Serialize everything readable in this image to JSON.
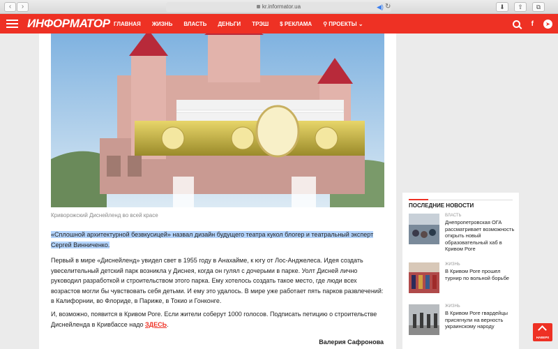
{
  "browser": {
    "url": "kr.informator.ua"
  },
  "header": {
    "logo": "ИНФОРМАТОР",
    "menu": [
      "ГЛАВНАЯ",
      "ЖИЗНЬ",
      "ВЛАСТЬ",
      "ДЕНЬГИ",
      "ТРЭШ",
      "$ РЕКЛАМА",
      "⚲ ПРОЕКТЫ ⌄"
    ],
    "brand_color": "#ee3124"
  },
  "article": {
    "caption": "Криворожский Диснейленд во всей красе",
    "lead": "«Сплошной архитектурной безвкусицей» назвал дизайн будущего театра кукол блогер и театральный эксперт Сергей Винниченко.",
    "p1": "Первый в мире «Диснейленд» увидел свет в 1955 году в Анахайме, к югу от Лос-Анджелеса. Идея создать увеселительный детский парк возникла у Диснея, когда он гулял с дочерьми в парке. Уолт Дисней лично руководил разработкой и строительством этого парка. Ему хотелось создать такое место, где люди всех возрастов могли бы чувствовать себя детьми. И ему это удалось. В мире уже работает пять парков развлечений: в Калифорнии, во Флориде, в Париже, в Токио и Гонконге.",
    "p2_text": "И, возможно, появится в Кривом Роге. Если жители соберут 1000 голосов. Подписать петицию о строительстве Диснейленда в Кривбассе надо ",
    "p2_link": "ЗДЕСЬ",
    "p2_end": ".",
    "author": "Валерия Сафронова"
  },
  "sidebar": {
    "title": "ПОСЛЕДНИЕ НОВОСТИ",
    "items": [
      {
        "category": "ВЛАСТЬ",
        "title": "Днепропетровская ОГА рассматривает возможность открыть новый образовательный хаб в Кривом Роге"
      },
      {
        "category": "ЖИЗНЬ",
        "title": "В Кривом Роге прошел турнир по вольной борьбе"
      },
      {
        "category": "ЖИЗНЬ",
        "title": "В Кривом Роге гвардейцы присягнули на верность украинскому народу"
      }
    ]
  },
  "to_top": {
    "label": "НАВЕРХ"
  }
}
